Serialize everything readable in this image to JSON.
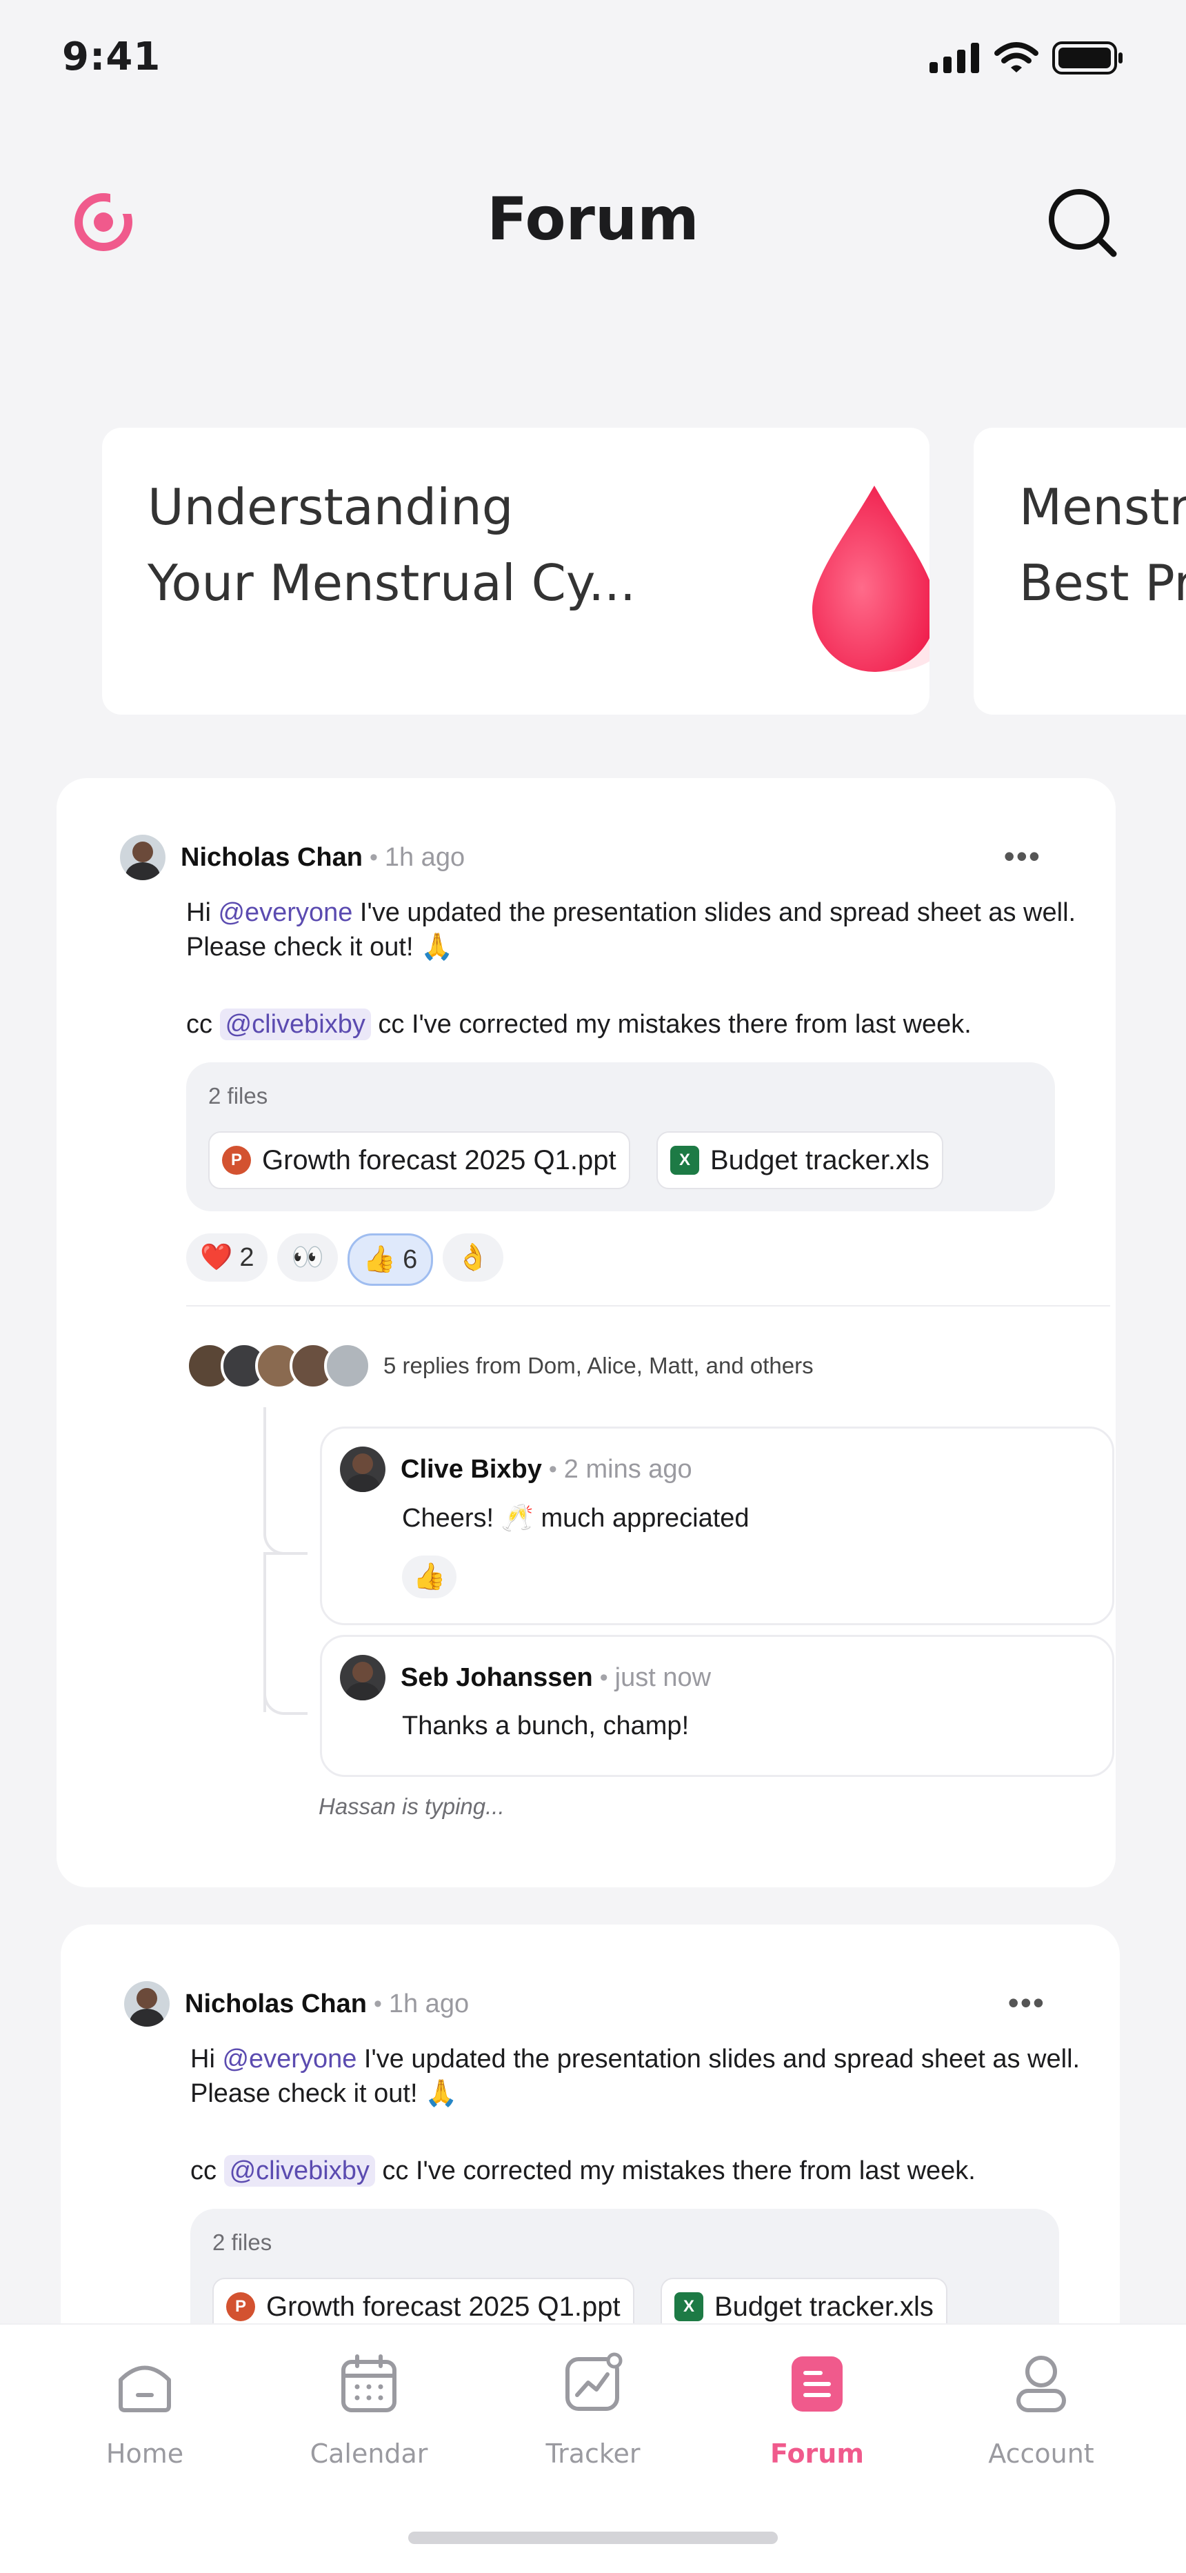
{
  "status": {
    "time": "9:41"
  },
  "header": {
    "title": "Forum"
  },
  "topics": [
    {
      "title": "Understanding\nYour Menstrual Cy..."
    },
    {
      "title": "Menstr\nBest Pr"
    }
  ],
  "posts": [
    {
      "author": "Nicholas Chan",
      "time": "1h ago",
      "more": "•••",
      "line1_prefix": "Hi ",
      "mention1": "@everyone",
      "line1_rest": " I've updated the presentation slides and spread sheet as well. Please check it out! 🙏",
      "line2_prefix": "cc ",
      "mention2": "@clivebixby",
      "line2_rest": " cc I've corrected my mistakes there from last week.",
      "files_label": "2 files",
      "files": [
        "Growth forecast 2025 Q1.ppt",
        "Budget tracker.xls"
      ],
      "reactions": [
        {
          "emoji": "❤️",
          "count": "2"
        },
        {
          "emoji": "👀",
          "count": ""
        },
        {
          "emoji": "👍",
          "count": "6"
        },
        {
          "emoji": "👌",
          "count": ""
        }
      ],
      "replies_summary": "5 replies from Dom, Alice, Matt, and others",
      "replies": [
        {
          "author": "Clive Bixby",
          "time": "2 mins ago",
          "text": "Cheers! 🥂 much appreciated",
          "reaction": "👍"
        },
        {
          "author": "Seb Johanssen",
          "time": "just now",
          "text": "Thanks a bunch, champ!"
        }
      ],
      "typing": "Hassan is typing..."
    },
    {
      "author": "Nicholas Chan",
      "time": "1h ago",
      "more": "•••",
      "line1_prefix": "Hi ",
      "mention1": "@everyone",
      "line1_rest": " I've updated the presentation slides and spread sheet as well. Please check it out! 🙏",
      "line2_prefix": "cc ",
      "mention2": "@clivebixby",
      "line2_rest": " cc I've corrected my mistakes there from last week.",
      "files_label": "2 files",
      "files": [
        "Growth forecast 2025 Q1.ppt",
        "Budget tracker.xls"
      ]
    }
  ],
  "tabs": [
    {
      "label": "Home",
      "icon": "home-icon"
    },
    {
      "label": "Calendar",
      "icon": "calendar-icon"
    },
    {
      "label": "Tracker",
      "icon": "tracker-icon"
    },
    {
      "label": "Forum",
      "icon": "forum-icon",
      "active": true
    },
    {
      "label": "Account",
      "icon": "account-icon"
    }
  ],
  "colors": {
    "accent": "#f05a8c",
    "mention": "#5b4bb0",
    "background": "#f4f4f6"
  }
}
